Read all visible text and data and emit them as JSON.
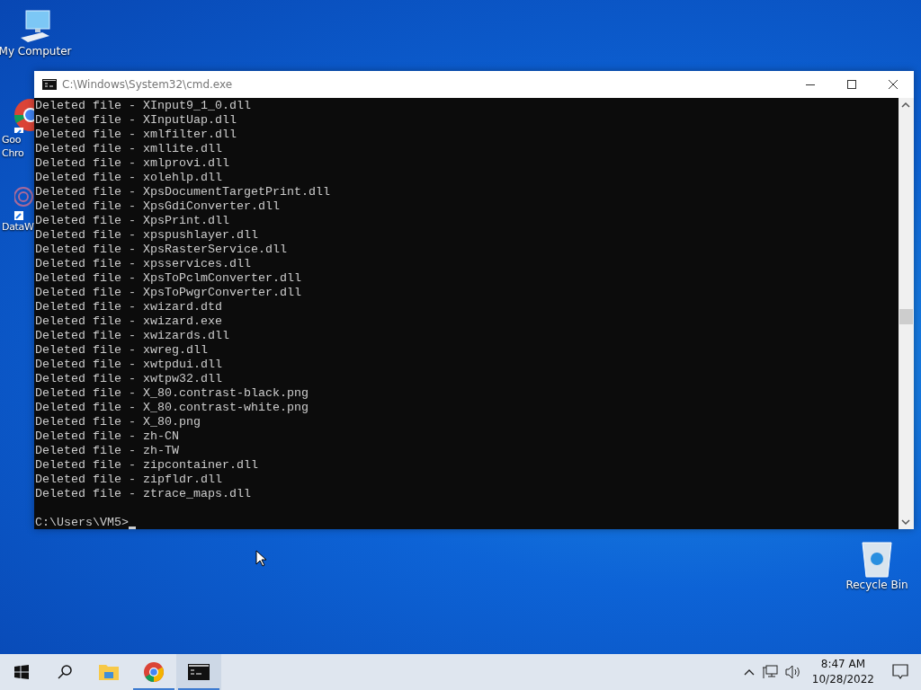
{
  "desktop_icons": [
    {
      "kind": "computer",
      "label_lines": [
        "My Computer"
      ]
    },
    {
      "kind": "chrome",
      "label_lines": [
        "Goo",
        "Chro"
      ]
    },
    {
      "kind": "dataw",
      "label_lines": [
        "DataW"
      ]
    },
    {
      "kind": "recycle",
      "label_lines": [
        "Recycle Bin"
      ]
    }
  ],
  "window": {
    "title": "C:\\Windows\\System32\\cmd.exe",
    "lines": [
      "Deleted file - XInput9_1_0.dll",
      "Deleted file - XInputUap.dll",
      "Deleted file - xmlfilter.dll",
      "Deleted file - xmllite.dll",
      "Deleted file - xmlprovi.dll",
      "Deleted file - xolehlp.dll",
      "Deleted file - XpsDocumentTargetPrint.dll",
      "Deleted file - XpsGdiConverter.dll",
      "Deleted file - XpsPrint.dll",
      "Deleted file - xpspushlayer.dll",
      "Deleted file - XpsRasterService.dll",
      "Deleted file - xpsservices.dll",
      "Deleted file - XpsToPclmConverter.dll",
      "Deleted file - XpsToPwgrConverter.dll",
      "Deleted file - xwizard.dtd",
      "Deleted file - xwizard.exe",
      "Deleted file - xwizards.dll",
      "Deleted file - xwreg.dll",
      "Deleted file - xwtpdui.dll",
      "Deleted file - xwtpw32.dll",
      "Deleted file - X_80.contrast-black.png",
      "Deleted file - X_80.contrast-white.png",
      "Deleted file - X_80.png",
      "Deleted file - zh-CN",
      "Deleted file - zh-TW",
      "Deleted file - zipcontainer.dll",
      "Deleted file - zipfldr.dll",
      "Deleted file - ztrace_maps.dll"
    ],
    "prompt": "C:\\Users\\VM5>"
  },
  "taskbar": {
    "apps": [
      {
        "kind": "explorer",
        "running": false,
        "selected": false
      },
      {
        "kind": "chrome",
        "running": true,
        "selected": false
      },
      {
        "kind": "cmd",
        "running": true,
        "selected": true
      }
    ],
    "time": "8:47 AM",
    "date": "10/28/2022"
  }
}
